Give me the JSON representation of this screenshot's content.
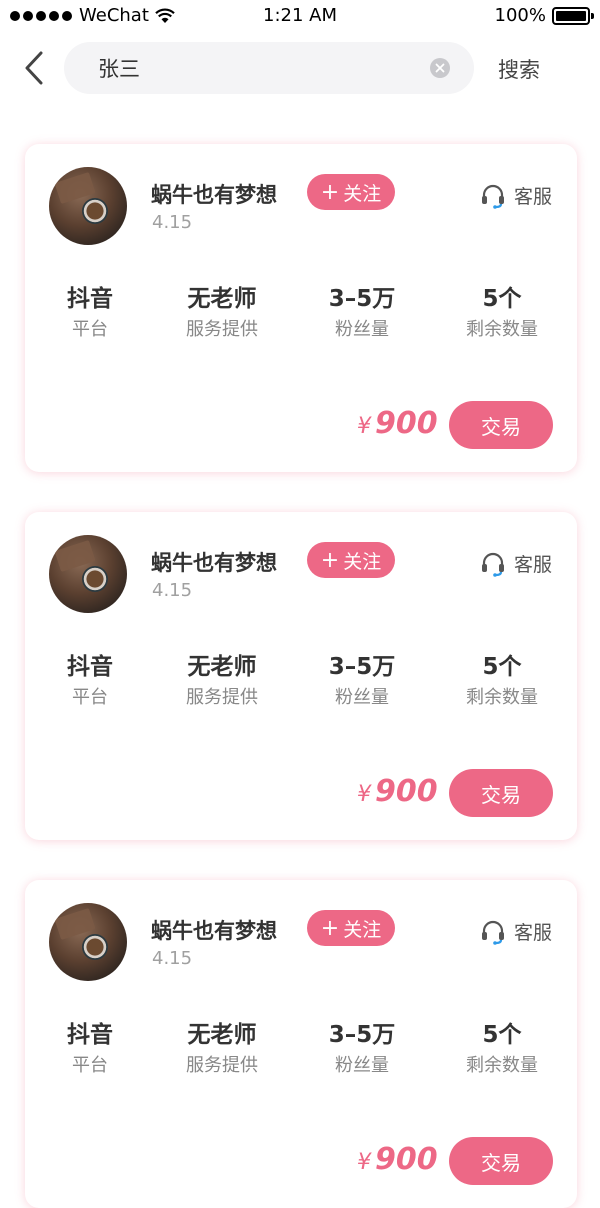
{
  "status_bar": {
    "carrier": "WeChat",
    "time": "1:21 AM",
    "battery": "100%"
  },
  "nav": {
    "search_value": "张三",
    "search_button": "搜索"
  },
  "listings": [
    {
      "name": "蜗牛也有梦想",
      "score": "4.15",
      "follow": "关注",
      "service": "客服",
      "stats": [
        {
          "value": "抖音",
          "label": "平台"
        },
        {
          "value": "无老师",
          "label": "服务提供"
        },
        {
          "value": "3–5万",
          "label": "粉丝量"
        },
        {
          "value": "5个",
          "label": "剩余数量"
        }
      ],
      "currency": "¥",
      "price": "900",
      "trade": "交易"
    },
    {
      "name": "蜗牛也有梦想",
      "score": "4.15",
      "follow": "关注",
      "service": "客服",
      "stats": [
        {
          "value": "抖音",
          "label": "平台"
        },
        {
          "value": "无老师",
          "label": "服务提供"
        },
        {
          "value": "3–5万",
          "label": "粉丝量"
        },
        {
          "value": "5个",
          "label": "剩余数量"
        }
      ],
      "currency": "¥",
      "price": "900",
      "trade": "交易"
    },
    {
      "name": "蜗牛也有梦想",
      "score": "4.15",
      "follow": "关注",
      "service": "客服",
      "stats": [
        {
          "value": "抖音",
          "label": "平台"
        },
        {
          "value": "无老师",
          "label": "服务提供"
        },
        {
          "value": "3–5万",
          "label": "粉丝量"
        },
        {
          "value": "5个",
          "label": "剩余数量"
        }
      ],
      "currency": "¥",
      "price": "900",
      "trade": "交易"
    }
  ],
  "colors": {
    "accent": "#ed6886",
    "headset": "#2e9ae8"
  }
}
